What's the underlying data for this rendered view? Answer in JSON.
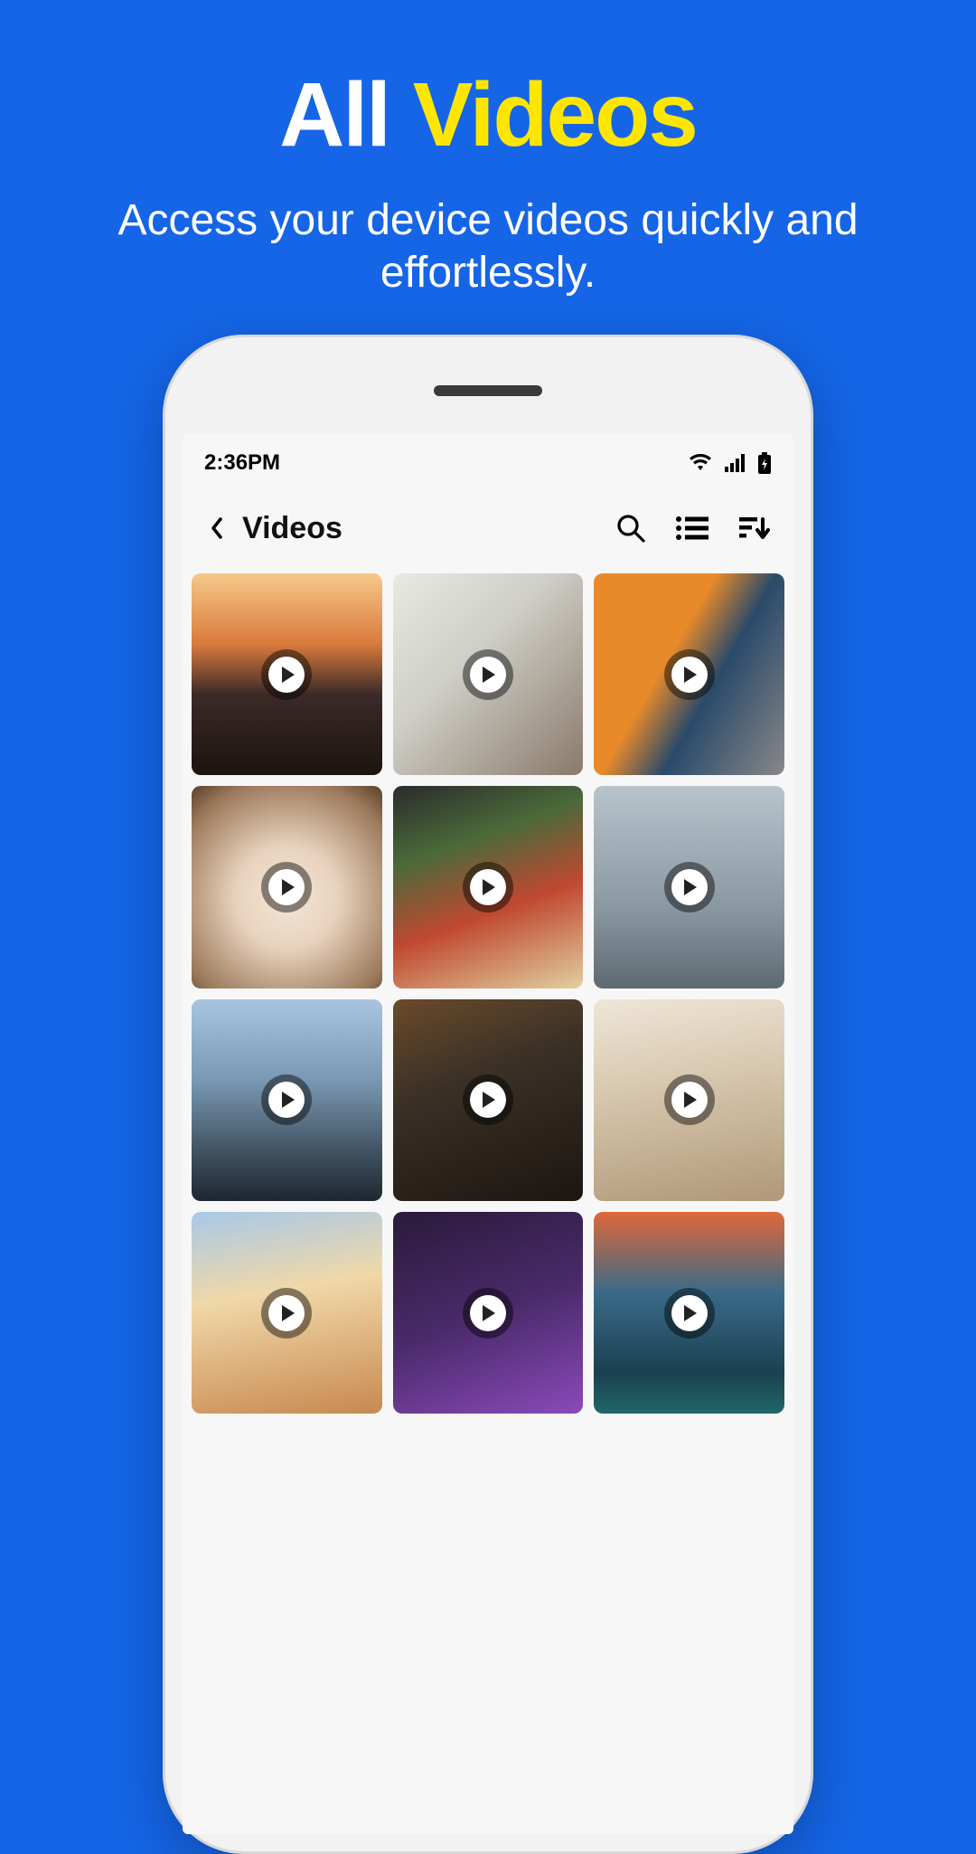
{
  "hero": {
    "title_word1": "All",
    "title_word2": "Videos",
    "subtitle": "Access your device videos quickly and effortlessly."
  },
  "statusbar": {
    "time": "2:36PM"
  },
  "appbar": {
    "title": "Videos"
  },
  "videos": [
    {
      "id": 1
    },
    {
      "id": 2
    },
    {
      "id": 3
    },
    {
      "id": 4
    },
    {
      "id": 5
    },
    {
      "id": 6
    },
    {
      "id": 7
    },
    {
      "id": 8
    },
    {
      "id": 9
    },
    {
      "id": 10
    },
    {
      "id": 11
    },
    {
      "id": 12
    }
  ]
}
